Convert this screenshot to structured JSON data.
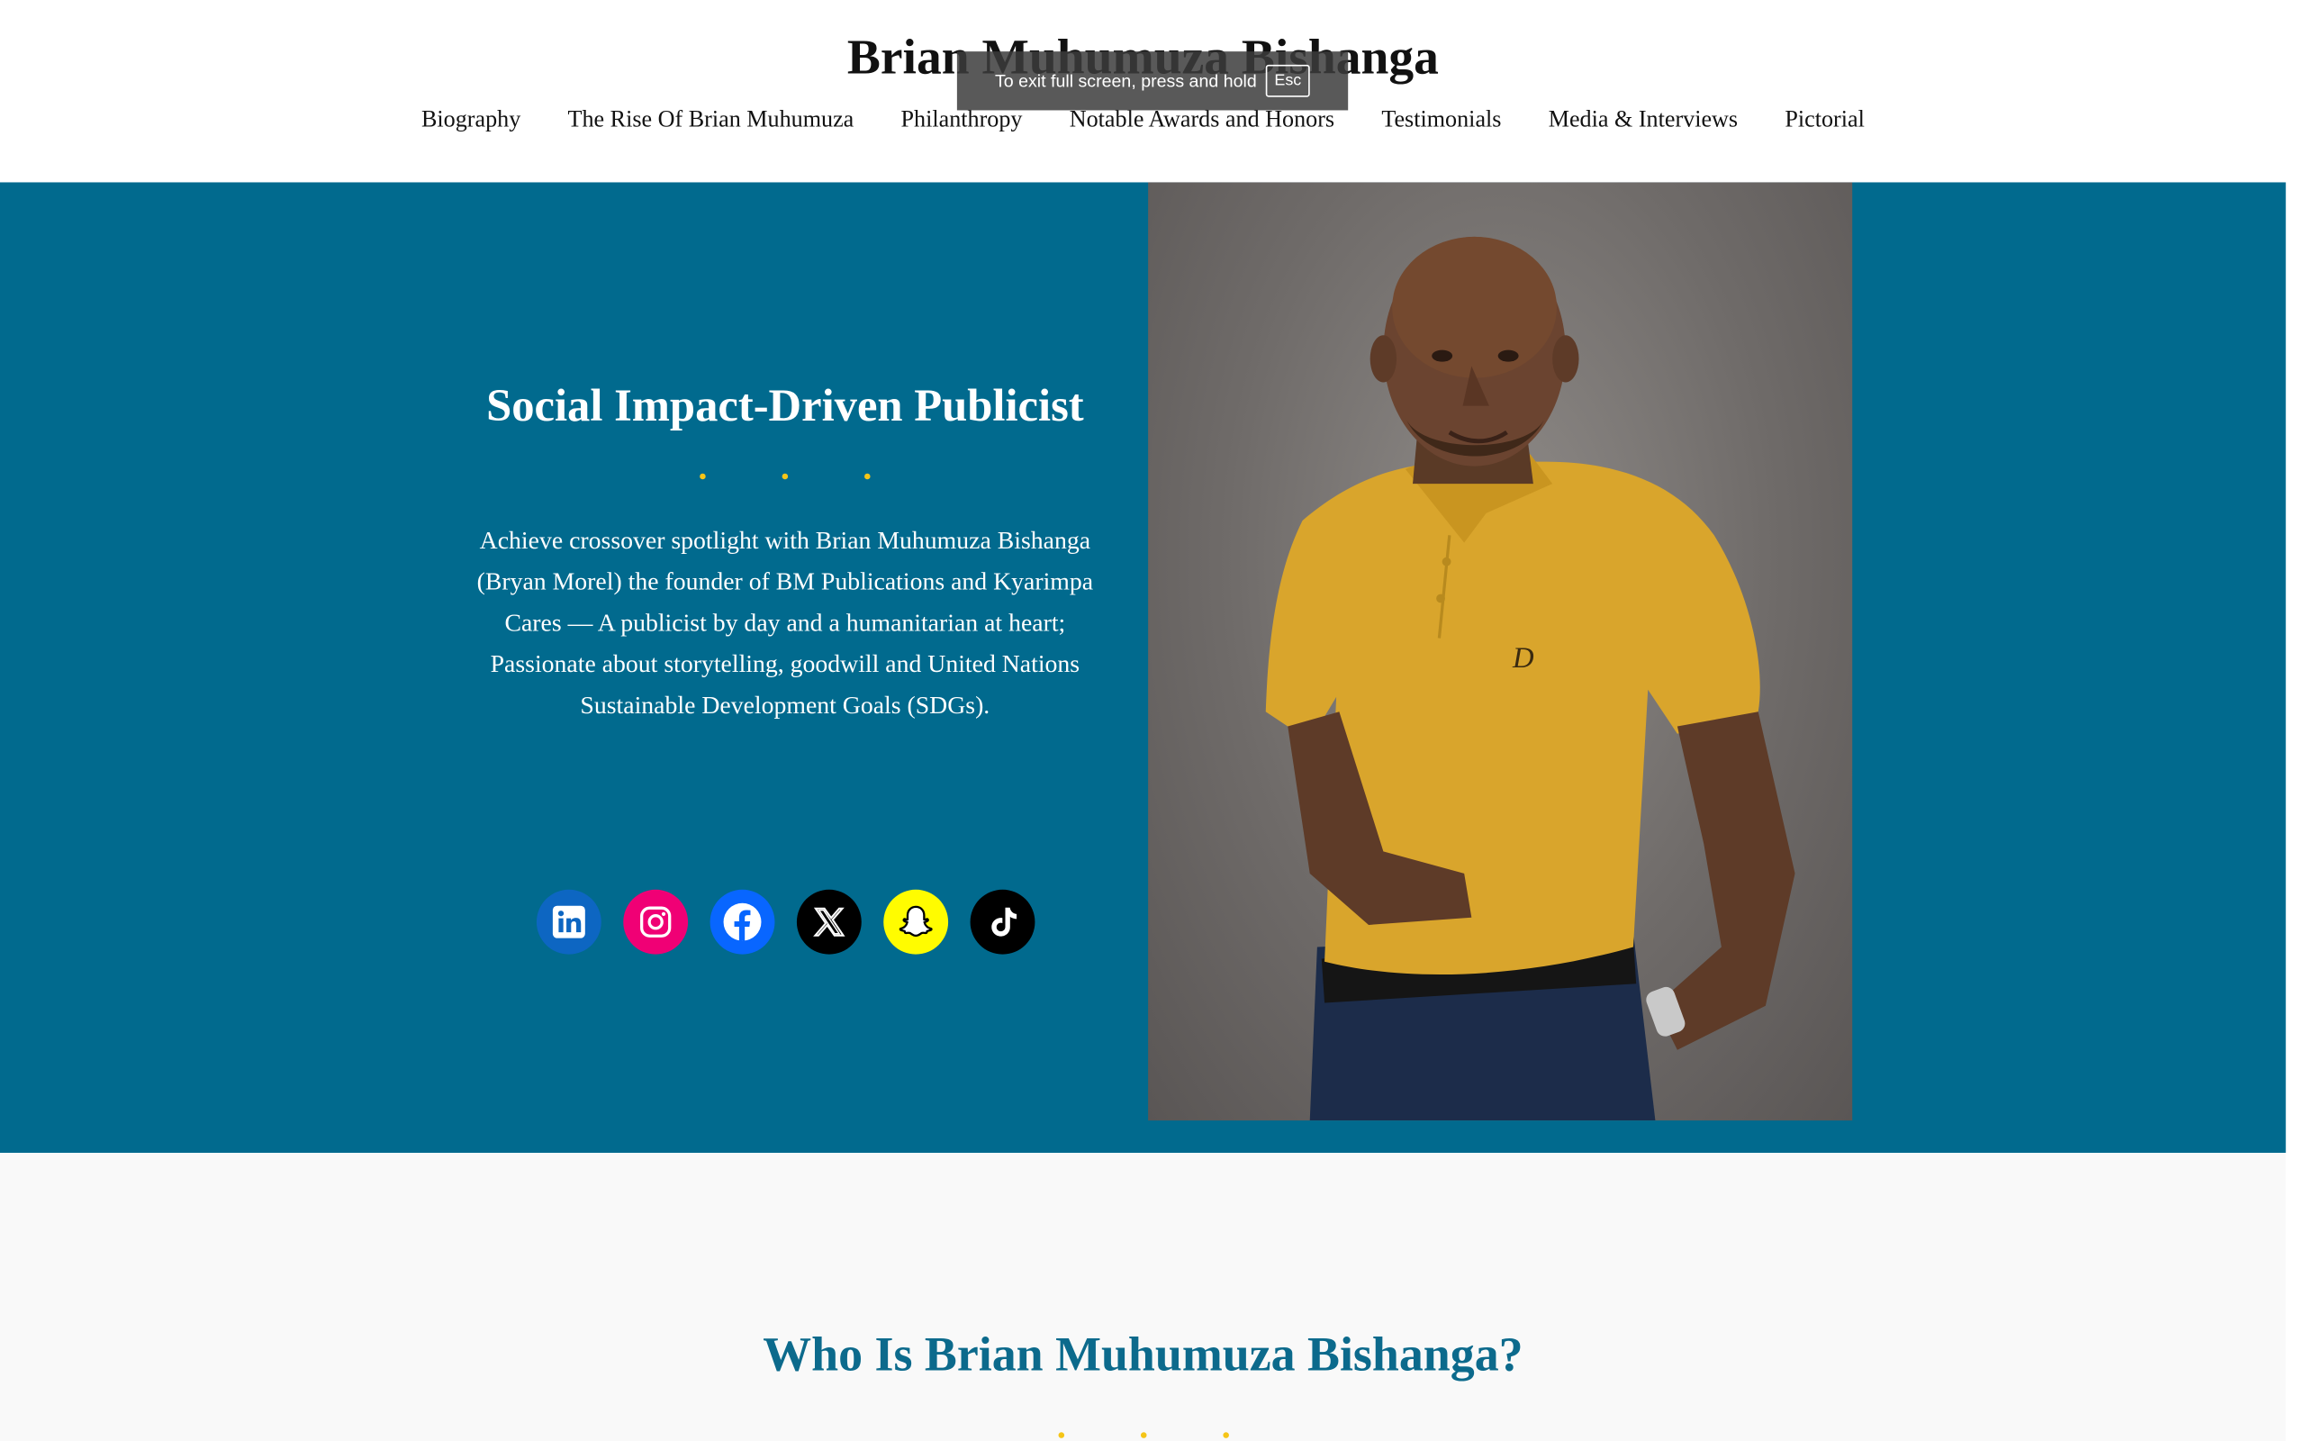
{
  "site": {
    "title": "Brian Muhumuza Bishanga"
  },
  "nav": {
    "items": [
      {
        "label": "Biography"
      },
      {
        "label": "The Rise Of Brian Muhumuza"
      },
      {
        "label": "Philanthropy"
      },
      {
        "label": "Notable Awards and Honors"
      },
      {
        "label": "Testimonials"
      },
      {
        "label": "Media & Interviews"
      },
      {
        "label": "Pictorial"
      }
    ]
  },
  "fullscreen_notice": {
    "text": "To exit full screen, press and hold",
    "key": "Esc"
  },
  "hero": {
    "title": "Social Impact-Driven Publicist",
    "text": "Achieve crossover spotlight with Brian Muhumuza Bishanga (Bryan Morel) the founder of BM Publications and Kyarimpa Cares — A publicist by day and a humanitarian at heart; Passionate about storytelling, goodwill and United Nations Sustainable Development Goals (SDGs).",
    "photo_shirt_letter": "D",
    "social": [
      {
        "name": "linkedin-icon",
        "color": "#0d66c2"
      },
      {
        "name": "instagram-icon",
        "color": "#f00075"
      },
      {
        "name": "facebook-icon",
        "color": "#0866ff"
      },
      {
        "name": "x-icon",
        "color": "#000000"
      },
      {
        "name": "snapchat-icon",
        "color": "#fffc00"
      },
      {
        "name": "tiktok-icon",
        "color": "#000000"
      }
    ]
  },
  "about": {
    "title": "Who Is Brian Muhumuza Bishanga?"
  },
  "colors": {
    "hero_bg": "#016a8e",
    "accent_dots": "#f5c518",
    "about_title": "#0c6a8c"
  }
}
